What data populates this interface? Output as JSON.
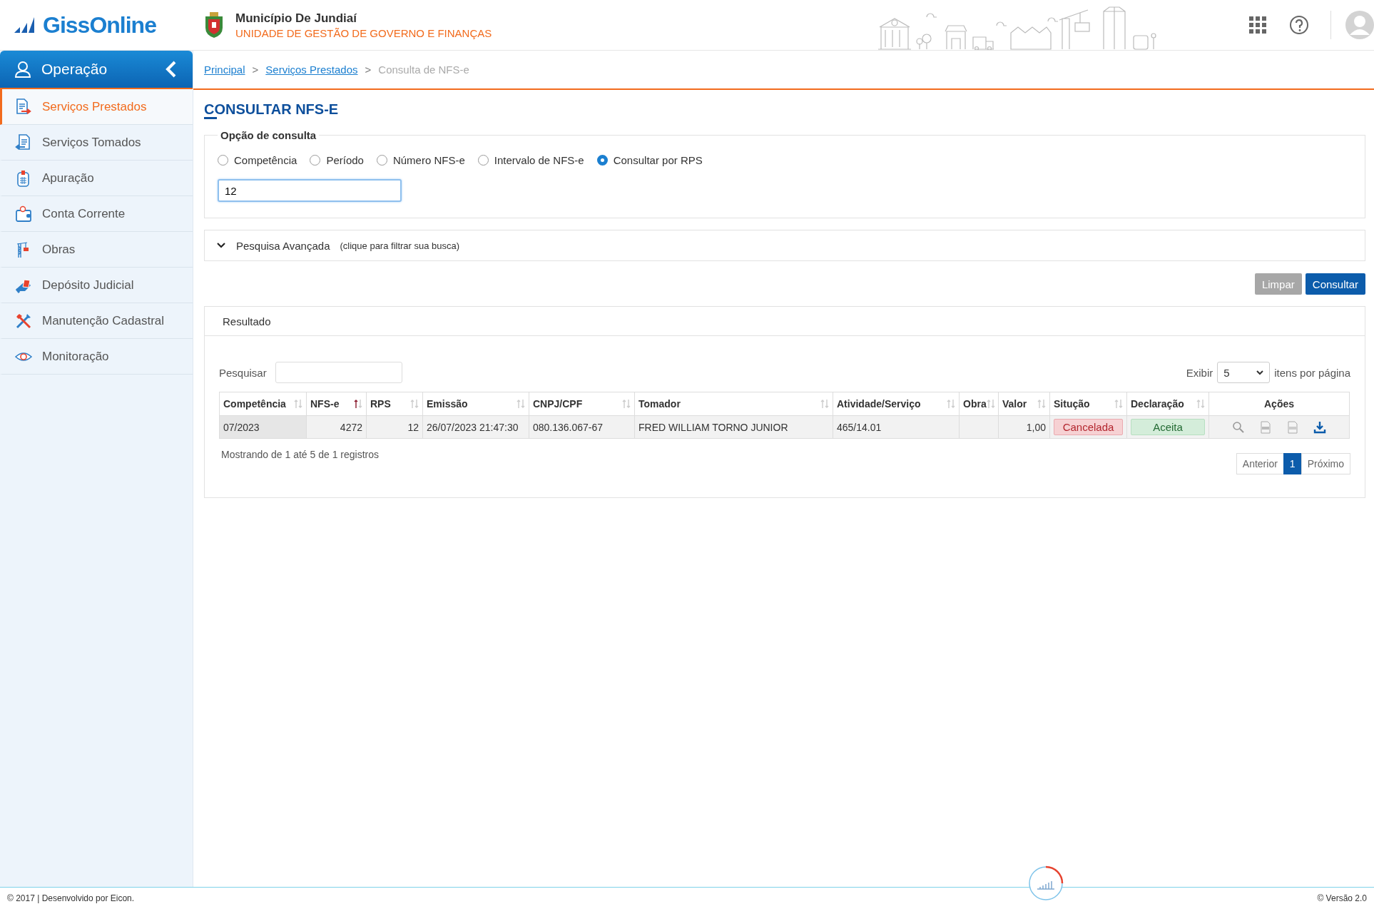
{
  "brand": {
    "logo": "GissOnline"
  },
  "municipality": {
    "name": "Município De Jundiaí",
    "unit": "UNIDADE DE GESTÃO DE GOVERNO E FINANÇAS"
  },
  "sidebar": {
    "title": "Operação",
    "items": [
      {
        "label": "Serviços Prestados",
        "selected": true,
        "kind": "doc-out"
      },
      {
        "label": "Serviços Tomados",
        "selected": false,
        "kind": "doc-in"
      },
      {
        "label": "Apuração",
        "selected": false,
        "kind": "calculator"
      },
      {
        "label": "Conta Corrente",
        "selected": false,
        "kind": "wallet"
      },
      {
        "label": "Obras",
        "selected": false,
        "kind": "crane"
      },
      {
        "label": "Depósito Judicial",
        "selected": false,
        "kind": "hand"
      },
      {
        "label": "Manutenção Cadastral",
        "selected": false,
        "kind": "tools"
      },
      {
        "label": "Monitoração",
        "selected": false,
        "kind": "eye"
      }
    ]
  },
  "breadcrumb": {
    "separator": ">",
    "items": [
      {
        "label": "Principal",
        "kind": "link"
      },
      {
        "label": "Serviços Prestados",
        "kind": "link"
      },
      {
        "label": "Consulta de NFS-e",
        "kind": "current"
      }
    ]
  },
  "page_title": "CONSULTAR NFS-E",
  "query_options": {
    "legend": "Opção de consulta",
    "value": "12",
    "options": [
      {
        "label": "Competência",
        "selected": false
      },
      {
        "label": "Período",
        "selected": false
      },
      {
        "label": "Número NFS-e",
        "selected": false
      },
      {
        "label": "Intervalo de NFS-e",
        "selected": false
      },
      {
        "label": "Consultar por RPS",
        "selected": true
      }
    ]
  },
  "advanced_search": {
    "label": "Pesquisa Avançada",
    "hint": "(clique para filtrar sua busca)",
    "expanded": false
  },
  "buttons": [
    {
      "label": "Limpar",
      "kind": "secondary"
    },
    {
      "label": "Consultar",
      "kind": "primary"
    }
  ],
  "result": {
    "title": "Resultado",
    "search_label": "Pesquisar",
    "page_size_label": "Exibir",
    "page_size": "5",
    "page_size_suffix": "itens por página",
    "columns": [
      {
        "label": "Competência",
        "sorted": false
      },
      {
        "label": "NFS-e",
        "sorted": true
      },
      {
        "label": "RPS",
        "sorted": false
      },
      {
        "label": "Emissão",
        "sorted": false
      },
      {
        "label": "CNPJ/CPF",
        "sorted": false
      },
      {
        "label": "Tomador",
        "sorted": false
      },
      {
        "label": "Atividade/Serviço",
        "sorted": false
      },
      {
        "label": "Obra",
        "sorted": false
      },
      {
        "label": "Valor",
        "sorted": false
      },
      {
        "label": "Situção",
        "sorted": false
      },
      {
        "label": "Declaração",
        "sorted": false
      },
      {
        "label": "Ações"
      }
    ],
    "rows": [
      {
        "cells": [
          "07/2023",
          "4272",
          "12",
          "26/07/2023 21:47:30",
          "080.136.067-67",
          "FRED WILLIAM TORNO JUNIOR",
          "465/14.01",
          null,
          "1,00",
          {
            "label": "Cancelada",
            "kind": "danger"
          },
          {
            "label": "Aceita",
            "kind": "success"
          }
        ]
      }
    ],
    "summary": "Mostrando de 1 até 5 de 1 registros",
    "pagination": [
      {
        "label": "Anterior",
        "selected": false
      },
      {
        "label": "1",
        "selected": true
      },
      {
        "label": "Próximo",
        "selected": false
      }
    ]
  },
  "footer": {
    "left": "© 2017 | Desenvolvido por Eicon.",
    "right": "© Versão 2.0"
  }
}
